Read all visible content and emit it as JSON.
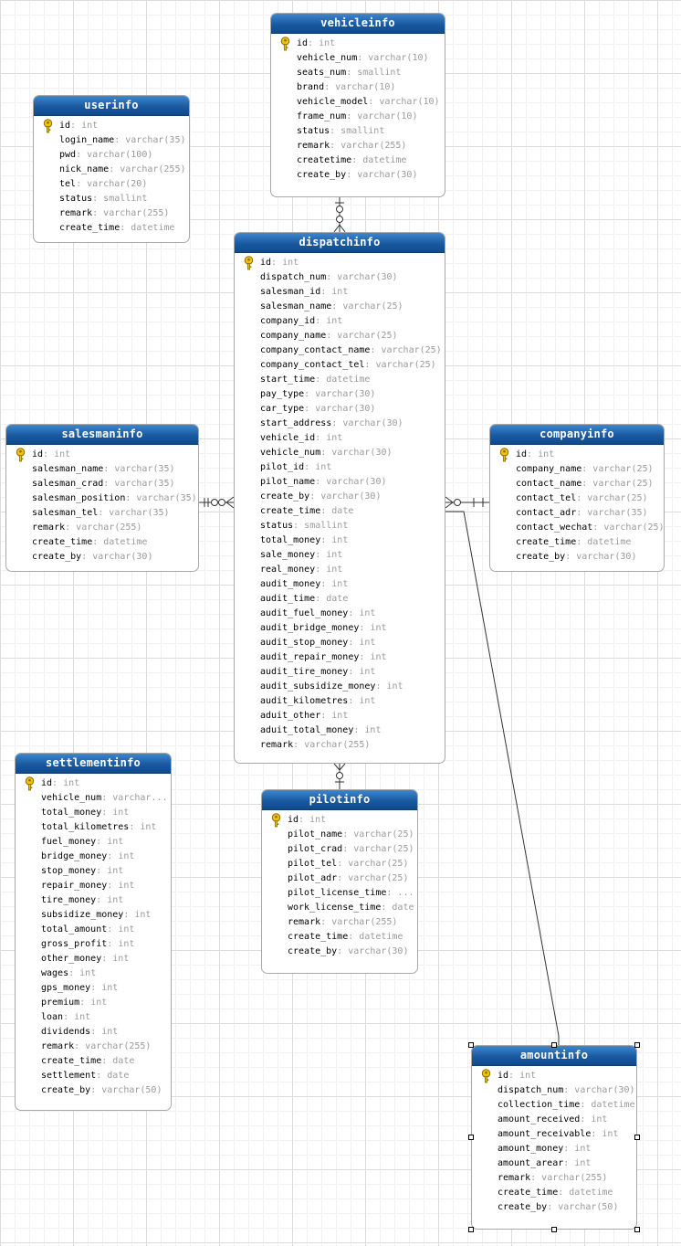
{
  "colors": {
    "header": "#1a5aa0",
    "key": "#f2c200",
    "line": "#333333"
  },
  "tables": [
    {
      "name": "vehicleinfo",
      "fields": [
        {
          "name": "id",
          "type": "int",
          "key": true
        },
        {
          "name": "vehicle_num",
          "type": "varchar(10)"
        },
        {
          "name": "seats_num",
          "type": "smallint"
        },
        {
          "name": "brand",
          "type": "varchar(10)"
        },
        {
          "name": "vehicle_model",
          "type": "varchar(10)"
        },
        {
          "name": "frame_num",
          "type": "varchar(10)"
        },
        {
          "name": "status",
          "type": "smallint"
        },
        {
          "name": "remark",
          "type": "varchar(255)"
        },
        {
          "name": "createtime",
          "type": "datetime"
        },
        {
          "name": "create_by",
          "type": "varchar(30)"
        }
      ]
    },
    {
      "name": "userinfo",
      "fields": [
        {
          "name": "id",
          "type": "int",
          "key": true
        },
        {
          "name": "login_name",
          "type": "varchar(35)"
        },
        {
          "name": "pwd",
          "type": "varchar(100)"
        },
        {
          "name": "nick_name",
          "type": "varchar(255)"
        },
        {
          "name": "tel",
          "type": "varchar(20)"
        },
        {
          "name": "status",
          "type": "smallint"
        },
        {
          "name": "remark",
          "type": "varchar(255)"
        },
        {
          "name": "create_time",
          "type": "datetime"
        }
      ]
    },
    {
      "name": "dispatchinfo",
      "fields": [
        {
          "name": "id",
          "type": "int",
          "key": true
        },
        {
          "name": "dispatch_num",
          "type": "varchar(30)"
        },
        {
          "name": "salesman_id",
          "type": "int"
        },
        {
          "name": "salesman_name",
          "type": "varchar(25)"
        },
        {
          "name": "company_id",
          "type": "int"
        },
        {
          "name": "company_name",
          "type": "varchar(25)"
        },
        {
          "name": "company_contact_name",
          "type": "varchar(25)"
        },
        {
          "name": "company_contact_tel",
          "type": "varchar(25)"
        },
        {
          "name": "start_time",
          "type": "datetime"
        },
        {
          "name": "pay_type",
          "type": "varchar(30)"
        },
        {
          "name": "car_type",
          "type": "varchar(30)"
        },
        {
          "name": "start_address",
          "type": "varchar(30)"
        },
        {
          "name": "vehicle_id",
          "type": "int"
        },
        {
          "name": "vehicle_num",
          "type": "varchar(30)"
        },
        {
          "name": "pilot_id",
          "type": "int"
        },
        {
          "name": "pilot_name",
          "type": "varchar(30)"
        },
        {
          "name": "create_by",
          "type": "varchar(30)"
        },
        {
          "name": "create_time",
          "type": "date"
        },
        {
          "name": "status",
          "type": "smallint"
        },
        {
          "name": "total_money",
          "type": "int"
        },
        {
          "name": "sale_money",
          "type": "int"
        },
        {
          "name": "real_money",
          "type": "int"
        },
        {
          "name": "audit_money",
          "type": "int"
        },
        {
          "name": "audit_time",
          "type": "date"
        },
        {
          "name": "audit_fuel_money",
          "type": "int"
        },
        {
          "name": "audit_bridge_money",
          "type": "int"
        },
        {
          "name": "audit_stop_money",
          "type": "int"
        },
        {
          "name": "audit_repair_money",
          "type": "int"
        },
        {
          "name": "audit_tire_money",
          "type": "int"
        },
        {
          "name": "audit_subsidize_money",
          "type": "int"
        },
        {
          "name": "audit_kilometres",
          "type": "int"
        },
        {
          "name": "aduit_other",
          "type": "int"
        },
        {
          "name": "aduit_total_money",
          "type": "int"
        },
        {
          "name": "remark",
          "type": "varchar(255)"
        }
      ]
    },
    {
      "name": "salesmaninfo",
      "fields": [
        {
          "name": "id",
          "type": "int",
          "key": true
        },
        {
          "name": "salesman_name",
          "type": "varchar(35)"
        },
        {
          "name": "salesman_crad",
          "type": "varchar(35)"
        },
        {
          "name": "salesman_position",
          "type": "varchar(35)"
        },
        {
          "name": "salesman_tel",
          "type": "varchar(35)"
        },
        {
          "name": "remark",
          "type": "varchar(255)"
        },
        {
          "name": "create_time",
          "type": "datetime"
        },
        {
          "name": "create_by",
          "type": "varchar(30)"
        }
      ]
    },
    {
      "name": "companyinfo",
      "fields": [
        {
          "name": "id",
          "type": "int",
          "key": true
        },
        {
          "name": "company_name",
          "type": "varchar(25)"
        },
        {
          "name": "contact_name",
          "type": "varchar(25)"
        },
        {
          "name": "contact_tel",
          "type": "varchar(25)"
        },
        {
          "name": "contact_adr",
          "type": "varchar(35)"
        },
        {
          "name": "contact_wechat",
          "type": "varchar(25)"
        },
        {
          "name": "create_time",
          "type": "datetime"
        },
        {
          "name": "create_by",
          "type": "varchar(30)"
        }
      ]
    },
    {
      "name": "settlementinfo",
      "fields": [
        {
          "name": "id",
          "type": "int",
          "key": true
        },
        {
          "name": "vehicle_num",
          "type": "varchar..."
        },
        {
          "name": "total_money",
          "type": "int"
        },
        {
          "name": "total_kilometres",
          "type": "int"
        },
        {
          "name": "fuel_money",
          "type": "int"
        },
        {
          "name": "bridge_money",
          "type": "int"
        },
        {
          "name": "stop_money",
          "type": "int"
        },
        {
          "name": "repair_money",
          "type": "int"
        },
        {
          "name": "tire_money",
          "type": "int"
        },
        {
          "name": "subsidize_money",
          "type": "int"
        },
        {
          "name": "total_amount",
          "type": "int"
        },
        {
          "name": "gross_profit",
          "type": "int"
        },
        {
          "name": "other_money",
          "type": "int"
        },
        {
          "name": "wages",
          "type": "int"
        },
        {
          "name": "gps_money",
          "type": "int"
        },
        {
          "name": "premium",
          "type": "int"
        },
        {
          "name": "loan",
          "type": "int"
        },
        {
          "name": "dividends",
          "type": "int"
        },
        {
          "name": "remark",
          "type": "varchar(255)"
        },
        {
          "name": "create_time",
          "type": "date"
        },
        {
          "name": "settlement",
          "type": "date"
        },
        {
          "name": "create_by",
          "type": "varchar(50)"
        }
      ]
    },
    {
      "name": "pilotinfo",
      "fields": [
        {
          "name": "id",
          "type": "int",
          "key": true
        },
        {
          "name": "pilot_name",
          "type": "varchar(25)"
        },
        {
          "name": "pilot_crad",
          "type": "varchar(25)"
        },
        {
          "name": "pilot_tel",
          "type": "varchar(25)"
        },
        {
          "name": "pilot_adr",
          "type": "varchar(25)"
        },
        {
          "name": "pilot_license_time",
          "type": "..."
        },
        {
          "name": "work_license_time",
          "type": "date"
        },
        {
          "name": "remark",
          "type": "varchar(255)"
        },
        {
          "name": "create_time",
          "type": "datetime"
        },
        {
          "name": "create_by",
          "type": "varchar(30)"
        }
      ]
    },
    {
      "name": "amountinfo",
      "fields": [
        {
          "name": "id",
          "type": "int",
          "key": true
        },
        {
          "name": "dispatch_num",
          "type": "varchar(30)"
        },
        {
          "name": "collection_time",
          "type": "datetime"
        },
        {
          "name": "amount_received",
          "type": "int"
        },
        {
          "name": "amount_receivable",
          "type": "int"
        },
        {
          "name": "amount_money",
          "type": "int"
        },
        {
          "name": "amount_arear",
          "type": "int"
        },
        {
          "name": "remark",
          "type": "varchar(255)"
        },
        {
          "name": "create_time",
          "type": "datetime"
        },
        {
          "name": "create_by",
          "type": "varchar(50)"
        }
      ]
    }
  ]
}
